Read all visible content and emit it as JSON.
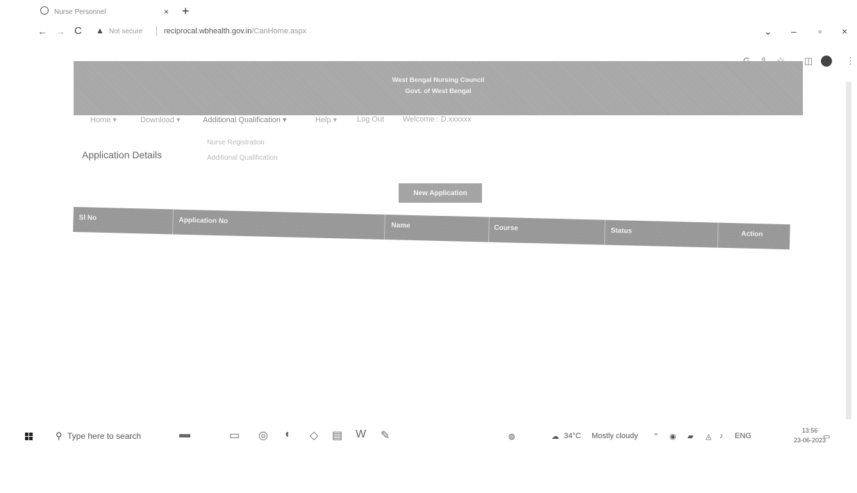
{
  "browser": {
    "tab_title": "Nurse Personnel",
    "tab_close": "×",
    "new_tab": "+",
    "security": "Not secure",
    "url_host": "reciprocal.wbhealth.gov.in",
    "url_path": "/CanHome.aspx"
  },
  "header": {
    "line1": "West Bengal Nursing Council",
    "line2": "Govt. of West Bengal"
  },
  "menu": {
    "home": "Home ▾",
    "download": "Download ▾",
    "additional_qualification": "Additional Qualification ▾",
    "help": "Help ▾",
    "logout": "Log Out",
    "welcome": "Welcome : D.xxxxxx"
  },
  "dropdown": {
    "item1": "Nurse Registration",
    "item2": "Additional Qualification"
  },
  "main": {
    "section_title": "Application Details",
    "new_application": "New Application"
  },
  "table": {
    "headers": [
      "Sl No",
      "Application No",
      "Name",
      "Course",
      "Status",
      "Action"
    ]
  },
  "taskbar": {
    "search_placeholder": "Type here to search",
    "weather_temp": "34°C",
    "weather_desc": "Mostly cloudy",
    "language": "ENG",
    "time": "13:56",
    "date": "23-06-2023"
  }
}
